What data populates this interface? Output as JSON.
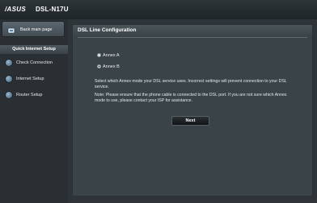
{
  "header": {
    "brand": "/ASUS",
    "model": "DSL-N17U"
  },
  "sidebar": {
    "back_label": "Back main page",
    "quick_title": "Quick Internet Setup",
    "items": [
      {
        "label": "Check Connection",
        "icon": "globe-icon"
      },
      {
        "label": "Internet Setup",
        "icon": "globe-icon"
      },
      {
        "label": "Router Setup",
        "icon": "globe-icon"
      }
    ]
  },
  "main": {
    "title": "DSL Line Configuration",
    "options": [
      {
        "label": "Annex A",
        "checked": false
      },
      {
        "label": "Annex B",
        "checked": true
      }
    ],
    "description": "Select which Annex mode your DSL service uses. Incorrect settings will prevent connection to your DSL service.",
    "note": "Note: Please ensure that the phone cable is connected to the DSL port. If you are not sure which Annex mode to use, please contact your ISP for assistance.",
    "next_label": "Next"
  }
}
